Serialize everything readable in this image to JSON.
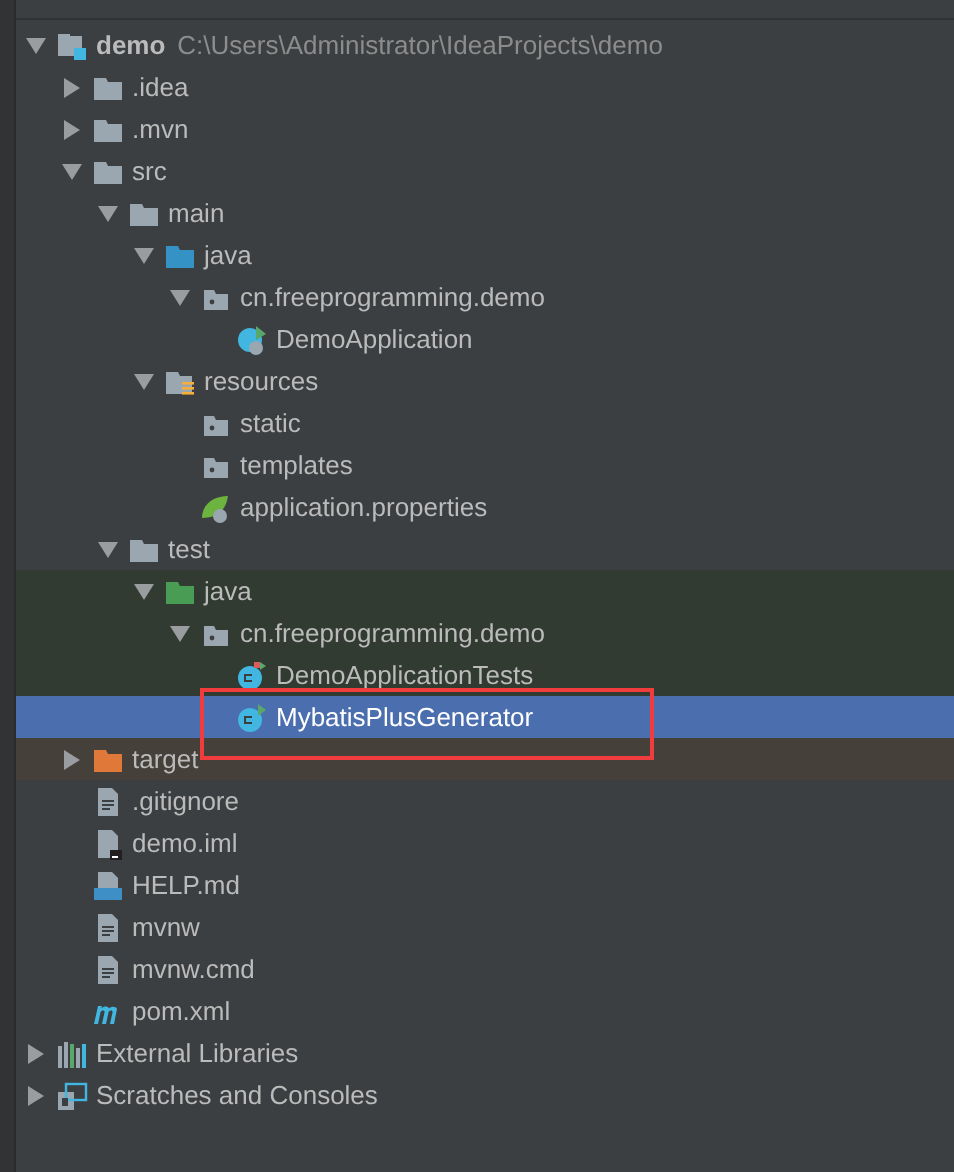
{
  "tree": [
    {
      "label": "demo",
      "path": "C:\\Users\\Administrator\\IdeaProjects\\demo",
      "kind": "module",
      "expanded": true,
      "selected": false,
      "children": [
        {
          "label": ".idea",
          "kind": "folder",
          "expanded": false,
          "selected": false
        },
        {
          "label": ".mvn",
          "kind": "folder",
          "expanded": false,
          "selected": false
        },
        {
          "label": "src",
          "kind": "folder",
          "expanded": true,
          "selected": false,
          "children": [
            {
              "label": "main",
              "kind": "folder",
              "expanded": true,
              "selected": false,
              "children": [
                {
                  "label": "java",
                  "kind": "source-folder",
                  "expanded": true,
                  "selected": false,
                  "children": [
                    {
                      "label": "cn.freeprogramming.demo",
                      "kind": "package",
                      "expanded": true,
                      "selected": false,
                      "children": [
                        {
                          "label": "DemoApplication",
                          "kind": "spring-class",
                          "selected": false
                        }
                      ]
                    }
                  ]
                },
                {
                  "label": "resources",
                  "kind": "resources-folder",
                  "expanded": true,
                  "selected": false,
                  "children": [
                    {
                      "label": "static",
                      "kind": "package",
                      "selected": false
                    },
                    {
                      "label": "templates",
                      "kind": "package",
                      "selected": false
                    },
                    {
                      "label": "application.properties",
                      "kind": "properties",
                      "selected": false
                    }
                  ]
                }
              ]
            },
            {
              "label": "test",
              "kind": "folder",
              "expanded": true,
              "selected": false,
              "children": [
                {
                  "label": "java",
                  "kind": "test-folder",
                  "expanded": true,
                  "selected": false,
                  "tinted": true,
                  "children": [
                    {
                      "label": "cn.freeprogramming.demo",
                      "kind": "package",
                      "expanded": true,
                      "selected": false,
                      "tinted": true,
                      "children": [
                        {
                          "label": "DemoApplicationTests",
                          "kind": "test-class",
                          "selected": false,
                          "tinted": true
                        },
                        {
                          "label": "MybatisPlusGenerator",
                          "kind": "run-class",
                          "selected": true,
                          "highlighted": true
                        }
                      ]
                    }
                  ]
                }
              ]
            }
          ]
        },
        {
          "label": "target",
          "kind": "excluded-folder",
          "expanded": false,
          "selected": false,
          "excluded": true
        },
        {
          "label": ".gitignore",
          "kind": "text-file",
          "selected": false
        },
        {
          "label": "demo.iml",
          "kind": "iml-file",
          "selected": false
        },
        {
          "label": "HELP.md",
          "kind": "markdown-file",
          "selected": false
        },
        {
          "label": "mvnw",
          "kind": "text-file",
          "selected": false
        },
        {
          "label": "mvnw.cmd",
          "kind": "text-file",
          "selected": false
        },
        {
          "label": "pom.xml",
          "kind": "maven-file",
          "selected": false
        }
      ]
    },
    {
      "label": "External Libraries",
      "kind": "libraries",
      "expanded": false,
      "selected": false
    },
    {
      "label": "Scratches and Consoles",
      "kind": "scratches",
      "expanded": false,
      "selected": false
    }
  ]
}
